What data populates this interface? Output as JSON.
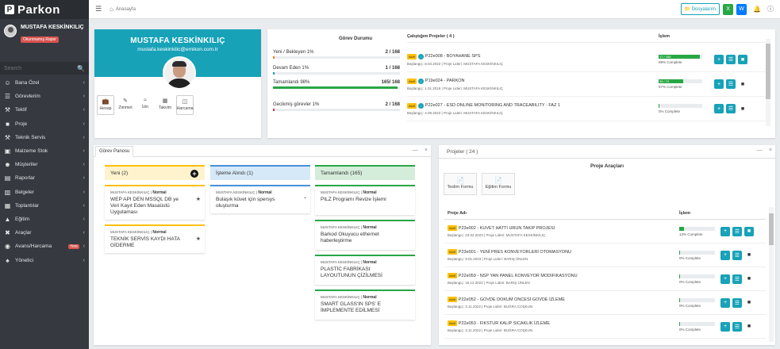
{
  "brand": {
    "name": "Parkon"
  },
  "user": {
    "name": "MUSTAFA KESKİNKILIÇ",
    "badge": "Okunmamış Rapor"
  },
  "search": {
    "placeholder": "Search"
  },
  "menu": [
    {
      "label": "Bana Özel",
      "icon": "person-icon"
    },
    {
      "label": "Görevlerim",
      "icon": "list-icon"
    },
    {
      "label": "Teklif",
      "icon": "gavel-icon"
    },
    {
      "label": "Proje",
      "icon": "folder-icon"
    },
    {
      "label": "Teknik Servis",
      "icon": "wrench-icon"
    },
    {
      "label": "Malzeme Stok",
      "icon": "truck-icon"
    },
    {
      "label": "Müşteriler",
      "icon": "users-icon"
    },
    {
      "label": "Raporlar",
      "icon": "report-icon"
    },
    {
      "label": "Belgeler",
      "icon": "documents-icon"
    },
    {
      "label": "Toplantılar",
      "icon": "meeting-icon"
    },
    {
      "label": "Eğitim",
      "icon": "education-icon"
    },
    {
      "label": "Araçlar",
      "icon": "tools-icon"
    },
    {
      "label": "Avans/Harcama",
      "icon": "money-icon",
      "badge": "Yeni"
    },
    {
      "label": "Yönetici",
      "icon": "admin-icon"
    }
  ],
  "topbar": {
    "breadcrumb": "Anasayfa",
    "files_button": "Dosyalarım"
  },
  "profile": {
    "name": "MUSTAFA KESKİNKILIÇ",
    "email": "mustafa.keskinkilic@emikon.com.tr",
    "buttons": [
      "Hesap",
      "Zimmet",
      "İzin",
      "Takvim",
      "Harcama"
    ]
  },
  "gorev": {
    "title": "Görev Durumu",
    "rows": [
      {
        "label": "Yeni / Bekleyen 1%",
        "value": "2 / 168",
        "pct": 1,
        "color": "#fd7e14"
      },
      {
        "label": "Devam Eden 1%",
        "value": "1 / 168",
        "pct": 1,
        "color": "#17a2b8"
      },
      {
        "label": "Tamamlandı 98%",
        "value": "165/ 168",
        "pct": 98,
        "color": "#28a745"
      },
      {
        "label": "Gecikmiş görevler 1%",
        "value": "2 / 168",
        "pct": 1,
        "color": "#dc3545"
      }
    ]
  },
  "projects_top": {
    "header": "Çalıştığım Projeler ( 4 )",
    "islem": "İşlem",
    "items": [
      {
        "code": "P22e008 - BOYAHANE SPS",
        "sub": "Başlangıç: 8.03.2022 | Proje Lideri: MUSTAFA KESKİNKILIÇ",
        "bar": "17 / 168",
        "pct": 95,
        "complete": "99% Complete",
        "tag": "Aktif"
      },
      {
        "code": "P19e024 - PARKON",
        "sub": "Başlangıç: 1.01.2019 | Proje Lideri: MUSTAFA KESKİNKILIÇ",
        "bar": "35 / 73",
        "pct": 57,
        "complete": "57% Complete",
        "tag": "Aktif"
      },
      {
        "code": "P22e027 - ESD ONLINE MONITORING AND TRACEABILITY - FAZ 1",
        "sub": "Başlangıç: 4.09.2022 | Proje Lideri: MUSTAFA KESKİNKILIÇ",
        "bar": "",
        "pct": 0,
        "complete": "0% Complete",
        "tag": "Aktif"
      }
    ]
  },
  "board": {
    "tab": "Görev Panosu",
    "columns": [
      {
        "title": "Yeni (2)",
        "color": "#fff3cd",
        "border": "#ffc107",
        "cards": [
          {
            "owner": "MUSTAFA KESKİNKILIÇ",
            "priority": "Normal",
            "text": "WEP API DEN MSSQL DB ye Veri Kayıt Eden Masaüstü Uygulaması"
          },
          {
            "owner": "MUSTAFA KESKİNKILIÇ",
            "priority": "Normal",
            "text": "TEKNİK SERVİS KAYDI HATA GİDERME"
          }
        ]
      },
      {
        "title": "İşleme Alındı (1)",
        "color": "#d6e9f8",
        "border": "#4a90d9",
        "cards": [
          {
            "owner": "MUSTAFA KESKİNKILIÇ",
            "priority": "Normal",
            "text": "Bulaşık küvet için spersys oluşturma"
          }
        ]
      },
      {
        "title": "Tamamlandı (165)",
        "color": "#d4edda",
        "border": "#28a745",
        "cards": [
          {
            "owner": "MUSTAFA KESKİNKILIÇ",
            "priority": "Normal",
            "text": "PILZ Programı Revize İşlemi"
          },
          {
            "owner": "MUSTAFA KESKİNKILIÇ",
            "priority": "Normal",
            "text": "Barkod Okuyucu ethernet haberleştirme"
          },
          {
            "owner": "MUSTAFA KESKİNKILIÇ",
            "priority": "Normal",
            "text": "PLASTİC FABRİKASI LAYOUTUNUN ÇİZİLMESİ"
          },
          {
            "owner": "MUSTAFA KESKİNKILIÇ",
            "priority": "Normal",
            "text": "SMART GLASS'IN SPS' E İMPLEMENTE EDİLMESİ"
          }
        ]
      }
    ]
  },
  "projeler": {
    "header": "Projeler ( 24 )",
    "tools_title": "Proje Araçları",
    "tools": [
      "Teslim Formu",
      "Eğitim Formu"
    ],
    "col_name": "Proje Adı",
    "col_islem": "İşlem",
    "items": [
      {
        "code": "P23e002 - KUVET HATTI URUN TAKIP PROJESI",
        "sub": "Başlangıç: 23.02.2023 | Proje Lideri: MUSTAFA KESKİNKILIÇ",
        "complete": "13% Complete",
        "pct": 13,
        "tag": "Aktif"
      },
      {
        "code": "P23e001 - YENİ PRES KONVEYORLERİ OTOMASYONU",
        "sub": "Başlangıç: 9.01.2023 | Proje Lideri: BARIŞ ÜNLEN",
        "complete": "0% Complete",
        "pct": 0,
        "tag": "Aktif"
      },
      {
        "code": "P22e059 - NSP YAN PANEL KONVEYOR MODIFIKASYONU",
        "sub": "Başlangıç: 15.12.2022 | Proje Lideri: BARIŞ ÜNLEN",
        "complete": "0% Complete",
        "pct": 0,
        "tag": "Aktif"
      },
      {
        "code": "P22e052 - GOVDE DOKUM ONCESİ GOVDE İZLEME",
        "sub": "Başlangıç: 3.11.2022 | Proje Lideri: BUĞRA COŞKUN",
        "complete": "0% Complete",
        "pct": 0,
        "tag": "Aktif"
      },
      {
        "code": "P22e053 - FIKSTUR KALIP SICAKLIK İZLEME",
        "sub": "Başlangıç: 3.11.2022 | Proje Lideri: BUĞRA COŞKUN",
        "complete": "0% Complete",
        "pct": 0,
        "tag": "Aktif"
      }
    ]
  },
  "colors": {
    "accent": "#17a2b8",
    "sidebar": "#363a40",
    "success": "#28a745"
  }
}
